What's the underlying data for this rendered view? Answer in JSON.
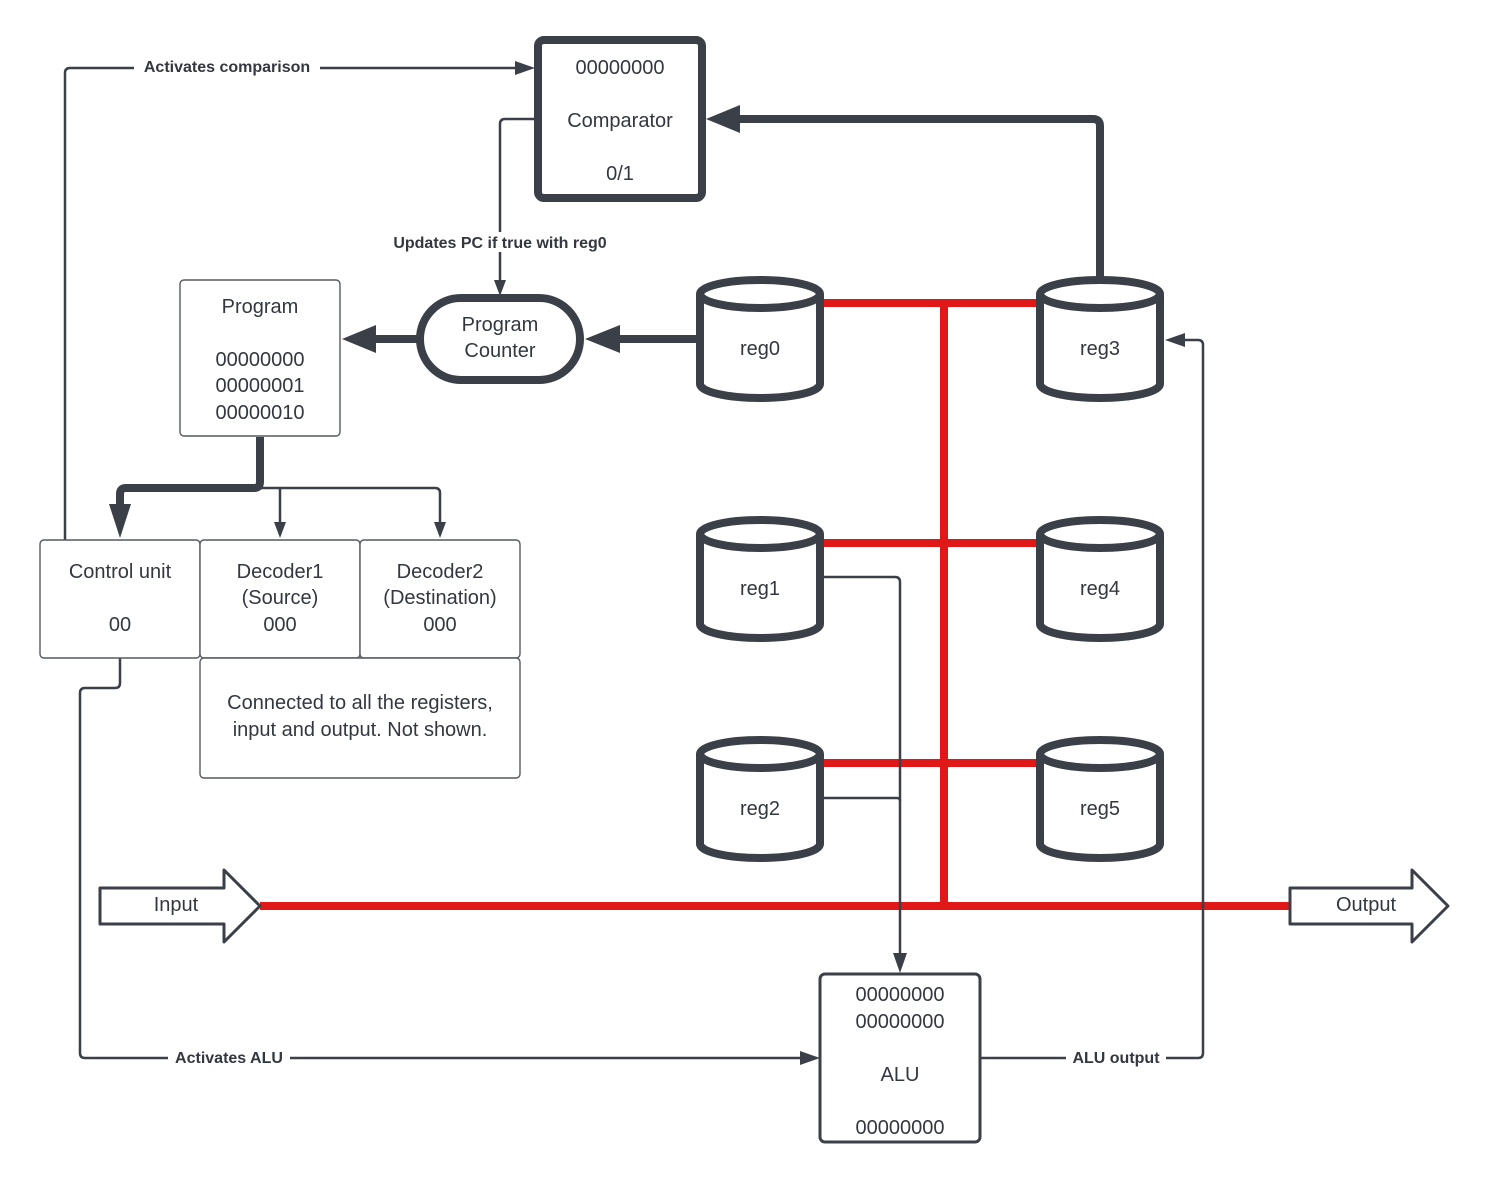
{
  "comparator": {
    "value": "00000000",
    "title": "Comparator",
    "result": "0/1"
  },
  "program": {
    "title": "Program",
    "instructions": [
      "00000000",
      "00000001",
      "00000010"
    ]
  },
  "program_counter": {
    "line1": "Program",
    "line2": "Counter"
  },
  "registers": [
    {
      "label": "reg0"
    },
    {
      "label": "reg1"
    },
    {
      "label": "reg2"
    },
    {
      "label": "reg3"
    },
    {
      "label": "reg4"
    },
    {
      "label": "reg5"
    }
  ],
  "control_unit": {
    "title": "Control unit",
    "value": "00"
  },
  "decoder1": {
    "title": "Decoder1",
    "subtitle": "(Source)",
    "value": "000"
  },
  "decoder2": {
    "title": "Decoder2",
    "subtitle": "(Destination)",
    "value": "000"
  },
  "note": {
    "line1": "Connected to all the registers,",
    "line2": "input and output. Not shown."
  },
  "io": {
    "input": "Input",
    "output": "Output"
  },
  "alu": {
    "operand_a": "00000000",
    "operand_b": "00000000",
    "title": "ALU",
    "result": "00000000"
  },
  "edge_labels": {
    "activates_comparison": "Activates comparison",
    "updates_pc": "Updates PC if true with reg0",
    "activates_alu": "Activates ALU",
    "alu_output": "ALU output"
  },
  "colors": {
    "bus": "#e01818",
    "stroke": "#3b3f47",
    "text": "#333740"
  }
}
